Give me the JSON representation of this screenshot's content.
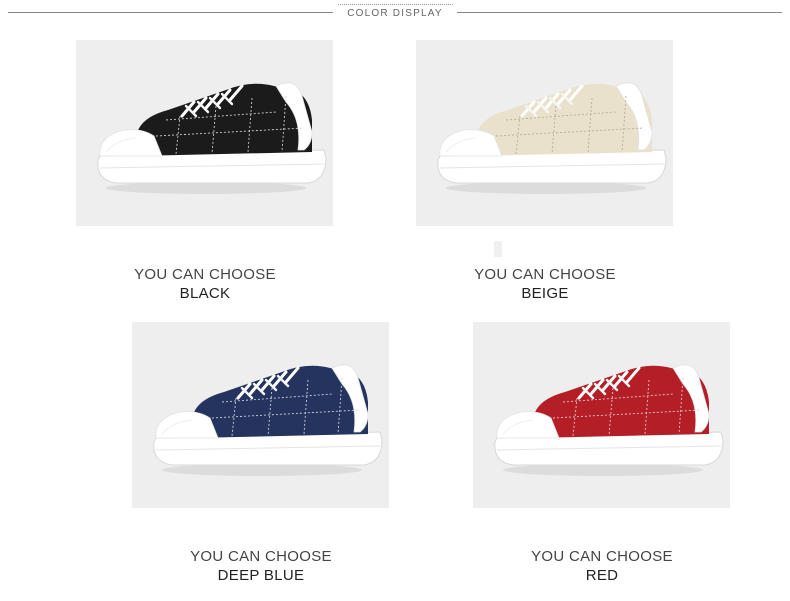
{
  "header": {
    "title": "COLOR DISPLAY"
  },
  "products": [
    {
      "choose_label": "YOU CAN CHOOSE",
      "color_name": "BLACK",
      "upper_color": "#1b1b1b",
      "stitch_color": "#cfcfcf"
    },
    {
      "choose_label": "YOU CAN CHOOSE",
      "color_name": "BEIGE",
      "upper_color": "#eae1cc",
      "stitch_color": "#b8ae98"
    },
    {
      "choose_label": "YOU CAN CHOOSE",
      "color_name": "DEEP BLUE",
      "upper_color": "#24345e",
      "stitch_color": "#c9cfdc"
    },
    {
      "choose_label": "YOU CAN CHOOSE",
      "color_name": "RED",
      "upper_color": "#b41e26",
      "stitch_color": "#e9c4c4"
    }
  ]
}
